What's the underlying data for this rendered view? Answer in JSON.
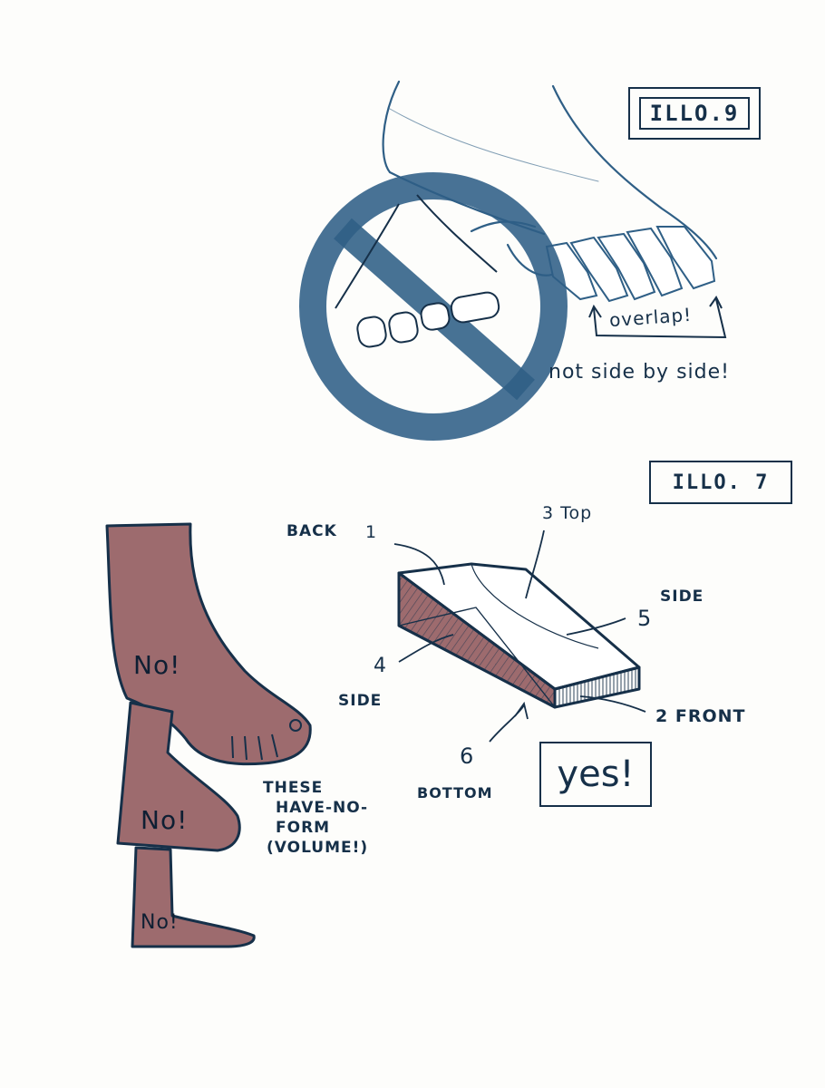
{
  "illo9": {
    "label": "ILLO.9",
    "overlap": "overlap!",
    "caption": "not side by side!"
  },
  "illo7": {
    "label": "ILLO. 7",
    "back": "BACK",
    "n1": "1",
    "top": "3 Top",
    "side_right": "SIDE",
    "n5": "5",
    "n4": "4",
    "side_left": "SIDE",
    "front": "2 FRONT",
    "n6": "6",
    "bottom": "BOTTOM",
    "yes": "yes!"
  },
  "no_feet": {
    "no1": "No!",
    "no2": "No!",
    "no3": "No!",
    "caption_lines": [
      "THESE",
      "HAVE-NO-",
      "FORM",
      "(VOLUME!)"
    ]
  },
  "colors": {
    "ink": "#163049",
    "pencil_blue": "#2f5f86",
    "foot_fill": "#9d6b6e",
    "paper": "#fdfdfb"
  }
}
